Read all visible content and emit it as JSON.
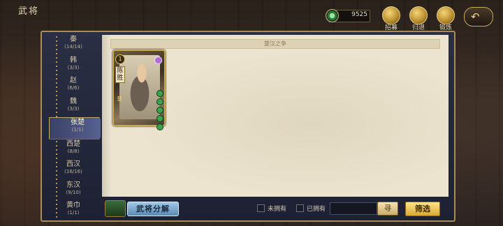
{
  "header": {
    "title": "武将",
    "currency_value": "9525",
    "buttons": [
      {
        "label": "招募",
        "icon": "recruit-icon"
      },
      {
        "label": "归退",
        "icon": "retire-icon"
      },
      {
        "label": "锻炼",
        "icon": "train-icon"
      }
    ],
    "back_icon": "back-arrow-icon"
  },
  "sidebar": {
    "items": [
      {
        "label": "秦",
        "count": "(14/14)"
      },
      {
        "label": "韩",
        "count": "(3/3)"
      },
      {
        "label": "赵",
        "count": "(6/6)"
      },
      {
        "label": "魏",
        "count": "(3/3)"
      },
      {
        "label": "张楚",
        "count": "(1/1)",
        "active": true
      },
      {
        "label": "西楚",
        "count": "(8/8)"
      },
      {
        "label": "西汉",
        "count": "(16/16)"
      },
      {
        "label": "东汉",
        "count": "(9/10)"
      },
      {
        "label": "黄巾",
        "count": "(1/1)"
      }
    ]
  },
  "panel": {
    "title": "楚汉之争",
    "cards": [
      {
        "name": "陈胜",
        "cost": "1",
        "faction": "楚",
        "pips": 5
      }
    ]
  },
  "bottom": {
    "decompose_label": "武将分解",
    "not_owned_label": "未拥有",
    "owned_label": "已拥有",
    "search_placeholder": "",
    "search_button": "寻",
    "filter_label": "筛选"
  }
}
